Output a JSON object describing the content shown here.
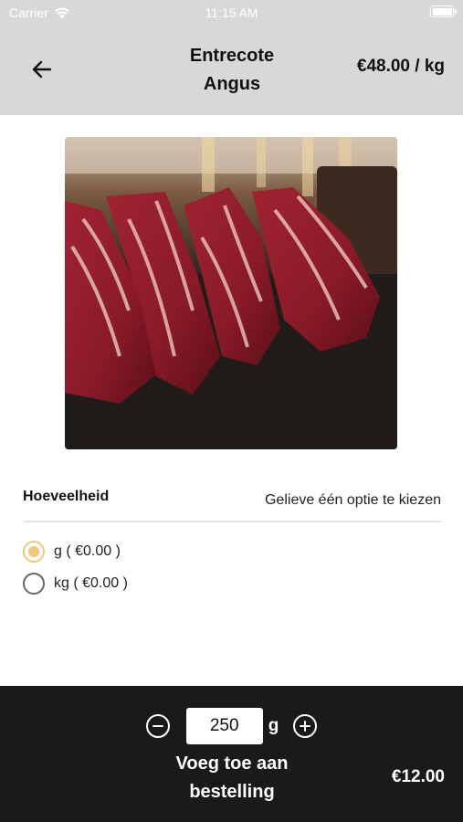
{
  "status_bar": {
    "carrier": "Carrier",
    "time": "11:15 AM"
  },
  "header": {
    "title_line1": "Entrecote",
    "title_line2": "Angus",
    "price": "€48.00 / kg",
    "background": "#d8d8d8"
  },
  "product_image": {
    "description_icon": "meat-photo"
  },
  "quantity_section": {
    "label": "Hoeveelheid",
    "hint": "Gelieve één optie te kiezen",
    "options": [
      {
        "label": "g ( €0.00 )",
        "selected": true
      },
      {
        "label": "kg ( €0.00 )",
        "selected": false
      }
    ],
    "accent": "#f2c777"
  },
  "footer": {
    "quantity_value": "250",
    "unit": "g",
    "add_line1": "Voeg toe aan",
    "add_line2": "bestelling",
    "total": "€12.00",
    "background": "#1a1a1a"
  }
}
